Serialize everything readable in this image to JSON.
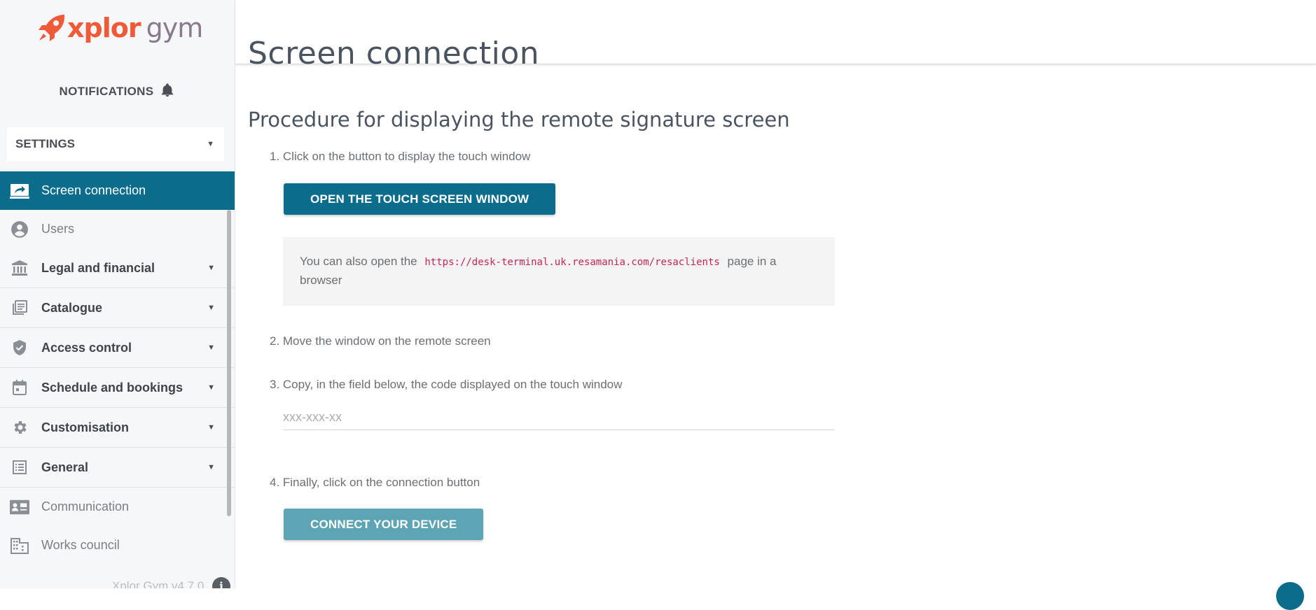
{
  "brand": {
    "name_part1": "xplor",
    "name_part2": "gym"
  },
  "sidebar": {
    "notifications_label": "NOTIFICATIONS",
    "section_select": "SETTINGS",
    "items": [
      {
        "label": "Screen connection",
        "icon": "monitor-link-icon",
        "active": true
      },
      {
        "label": "Users",
        "icon": "user-circle-icon"
      },
      {
        "label": "Legal and financial",
        "icon": "bank-icon",
        "group": true
      },
      {
        "label": "Catalogue",
        "icon": "library-icon",
        "group": true
      },
      {
        "label": "Access control",
        "icon": "shield-check-icon",
        "group": true
      },
      {
        "label": "Schedule and bookings",
        "icon": "calendar-icon",
        "group": true
      },
      {
        "label": "Customisation",
        "icon": "gear-icon",
        "group": true
      },
      {
        "label": "General",
        "icon": "list-icon",
        "group": true
      },
      {
        "label": "Communication",
        "icon": "contact-card-icon"
      },
      {
        "label": "Works council",
        "icon": "building-icon"
      }
    ],
    "version": "Xplor Gym v4.7.0"
  },
  "header": {
    "title": "Screen connection"
  },
  "main": {
    "procedure_title": "Procedure for displaying the remote signature screen",
    "step1": "1. Click on the button to display the touch window",
    "open_button": "OPEN THE TOUCH SCREEN WINDOW",
    "note_prefix": "You can also open the",
    "note_url": "https://desk-terminal.uk.resamania.com/resaclients",
    "note_suffix": "page in a browser",
    "step2": "2. Move the window on the remote screen",
    "step3": "3. Copy, in the field below, the code displayed on the touch window",
    "code_placeholder": "xxx-xxx-xx",
    "step4": "4. Finally, click on the connection button",
    "connect_button": "CONNECT YOUR DEVICE"
  },
  "colors": {
    "primary": "#0b6c8c",
    "primary_disabled": "#5da4b5",
    "brand_orange": "#ef5a38",
    "code": "#c7254e"
  }
}
